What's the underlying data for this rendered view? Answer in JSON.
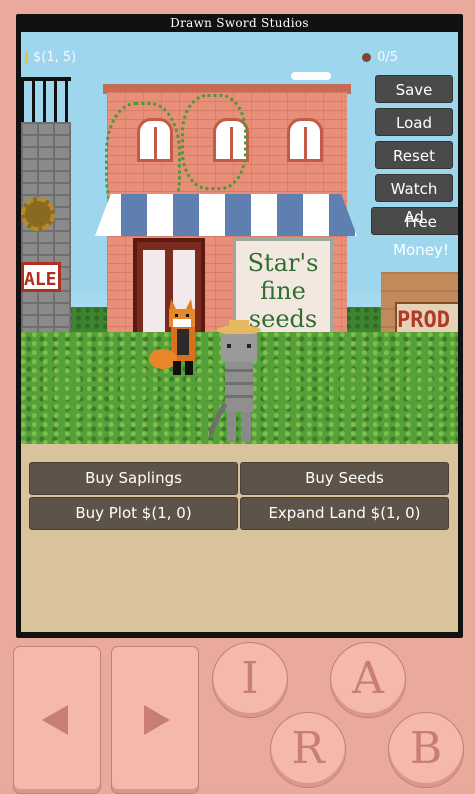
{
  "studio_title": "Drawn Sword Studios",
  "hud": {
    "money": "$(1, 5)",
    "seeds": "0/5"
  },
  "side_menu": {
    "save": "Save",
    "load": "Load",
    "reset": "Reset",
    "watch_ad": "Watch Ad",
    "free_money": "Free Money!"
  },
  "scene": {
    "shop_sign_line1": "Star's",
    "shop_sign_line2": "fine",
    "shop_sign_line3": "seeds",
    "left_sign": "ALE",
    "right_sign": "PROD"
  },
  "shop_buttons": {
    "buy_saplings": "Buy Saplings",
    "buy_seeds": "Buy Seeds",
    "buy_plot": "Buy Plot $(1, 0)",
    "expand_land": "Expand Land $(1, 0)"
  },
  "controller": {
    "i_label": "I",
    "a_label": "A",
    "r_label": "R",
    "b_label": "B"
  },
  "colors": {
    "device": "#e9a99b",
    "button_dark": "#4a4a4a",
    "shop_button": "#5e5349",
    "panel": "#d9c39b"
  }
}
